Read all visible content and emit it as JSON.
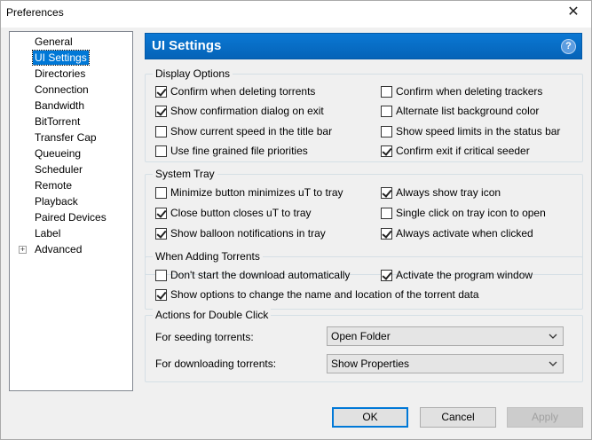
{
  "window": {
    "title": "Preferences",
    "close_glyph": "✕"
  },
  "tree": {
    "items": [
      {
        "label": "General"
      },
      {
        "label": "UI Settings",
        "selected": true
      },
      {
        "label": "Directories"
      },
      {
        "label": "Connection"
      },
      {
        "label": "Bandwidth"
      },
      {
        "label": "BitTorrent"
      },
      {
        "label": "Transfer Cap"
      },
      {
        "label": "Queueing"
      },
      {
        "label": "Scheduler"
      },
      {
        "label": "Remote"
      },
      {
        "label": "Playback"
      },
      {
        "label": "Paired Devices"
      },
      {
        "label": "Label"
      },
      {
        "label": "Advanced",
        "expander": "+"
      }
    ]
  },
  "header": {
    "title": "UI Settings",
    "help_glyph": "?"
  },
  "display_options": {
    "legend": "Display Options",
    "items": [
      {
        "label": "Confirm when deleting torrents",
        "checked": true
      },
      {
        "label": "Confirm when deleting trackers",
        "checked": false
      },
      {
        "label": "Show confirmation dialog on exit",
        "checked": true
      },
      {
        "label": "Alternate list background color",
        "checked": false
      },
      {
        "label": "Show current speed in the title bar",
        "checked": false
      },
      {
        "label": "Show speed limits in the status bar",
        "checked": false
      },
      {
        "label": "Use fine grained file priorities",
        "checked": false
      },
      {
        "label": "Confirm exit if critical seeder",
        "checked": true
      }
    ]
  },
  "system_tray": {
    "legend": "System Tray",
    "items": [
      {
        "label": "Minimize button minimizes uT to tray",
        "checked": false
      },
      {
        "label": "Always show tray icon",
        "checked": true
      },
      {
        "label": "Close button closes uT to tray",
        "checked": true
      },
      {
        "label": "Single click on tray icon to open",
        "checked": false
      },
      {
        "label": "Show balloon notifications in tray",
        "checked": true
      },
      {
        "label": "Always activate when clicked",
        "checked": true
      }
    ]
  },
  "adding_torrents": {
    "legend": "When Adding Torrents",
    "items": [
      {
        "label": "Don't start the download automatically",
        "checked": false
      },
      {
        "label": "Activate the program window",
        "checked": true
      },
      {
        "label": "Show options to change the name and location of the torrent data",
        "checked": true
      }
    ]
  },
  "double_click": {
    "legend": "Actions for Double Click",
    "seeding_label": "For seeding torrents:",
    "seeding_value": "Open Folder",
    "downloading_label": "For downloading torrents:",
    "downloading_value": "Show Properties"
  },
  "buttons": {
    "ok": "OK",
    "cancel": "Cancel",
    "apply": "Apply"
  },
  "colors": {
    "accent": "#0078d7",
    "header": "#0b78d4"
  }
}
